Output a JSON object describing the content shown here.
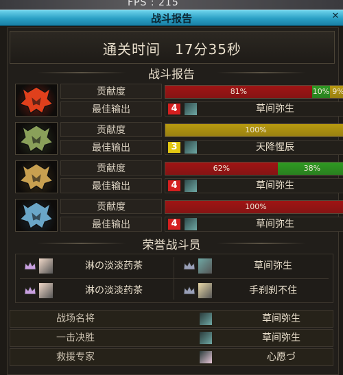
{
  "fps": "FPS : 215",
  "window_title": "战斗报告",
  "clear_time": "通关时间　17分35秒",
  "sections": {
    "report": "战斗报告",
    "honor": "荣誉战斗员"
  },
  "labels": {
    "contribution": "贡献度",
    "best_output": "最佳输出"
  },
  "colors": {
    "red": "#a01414",
    "green": "#2e9a22",
    "yellow": "#b89a10",
    "rank_red": "#d51f1f",
    "rank_yellow": "#e3c712"
  },
  "reports": [
    {
      "portrait": "red-flame-helmet-icon",
      "segments": [
        {
          "pct": 81,
          "color": "red",
          "label": "81%"
        },
        {
          "pct": 10,
          "color": "green",
          "label": "10%"
        },
        {
          "pct": 9,
          "color": "yellow",
          "label": "9%"
        }
      ],
      "rank": "4",
      "rank_color": "rank_red",
      "name": "草间弥生"
    },
    {
      "portrait": "green-horned-helmet-icon",
      "segments": [
        {
          "pct": 100,
          "color": "yellow",
          "label": "100%"
        }
      ],
      "rank": "3",
      "rank_color": "rank_yellow",
      "name": "天降惺辰"
    },
    {
      "portrait": "gold-horned-helmet-icon",
      "segments": [
        {
          "pct": 62,
          "color": "red",
          "label": "62%"
        },
        {
          "pct": 38,
          "color": "green",
          "label": "38%"
        }
      ],
      "rank": "4",
      "rank_color": "rank_red",
      "name": "草间弥生"
    },
    {
      "portrait": "blue-horned-helmet-icon",
      "segments": [
        {
          "pct": 100,
          "color": "red",
          "label": "100%"
        }
      ],
      "rank": "4",
      "rank_color": "rank_red",
      "name": "草间弥生"
    }
  ],
  "honor": [
    {
      "name": "淋の淡淡药茶"
    },
    {
      "name": "草间弥生"
    },
    {
      "name": "淋の淡淡药茶"
    },
    {
      "name": "手刹刹不住"
    }
  ],
  "awards": [
    {
      "label": "战场名将",
      "name": "草间弥生"
    },
    {
      "label": "一击决胜",
      "name": "草间弥生"
    },
    {
      "label": "救援专家",
      "name": "心愿づ"
    }
  ]
}
